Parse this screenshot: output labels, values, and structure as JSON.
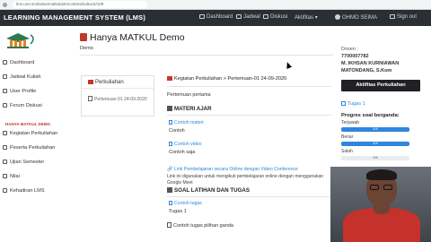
{
  "browser": {
    "url": "lms.umr.sm/kelas/matkul/ptmcontent/index/4/109"
  },
  "navbar": {
    "brand": "LEARNING MANAGEMENT SYSTEM (LMS)",
    "links": [
      "Dashboard",
      "Jadwal",
      "Diskusi",
      "Aktifitas"
    ],
    "user": "OHMO SEIMA",
    "signout": "Sign out"
  },
  "sidebar": {
    "items": [
      "Dashboard",
      "Jadwal Kuliah",
      "User Profile",
      "Forum Diskusi"
    ],
    "section_title": "HANYA MATKUL DEMO",
    "course_items": [
      "Kegiatan Perkuliahan",
      "Peserta Perkuliahan",
      "Ujian Semester",
      "Nilai",
      "Kehadiran LMS"
    ]
  },
  "main": {
    "title": "Hanya MATKUL Demo",
    "breadcrumb": "Demo",
    "lecture_card": {
      "header": "Perkuliahan",
      "item": "Pertemuan-01 24-09-2020"
    },
    "path": "Kegiatan Perkuliahan > Pertemuan-01 24-09-2020",
    "meeting_label": "Pertemuan pertama",
    "materi": {
      "heading": "MATERI AJAR",
      "items": [
        {
          "link": "Contoh materi",
          "text": "Contoh"
        },
        {
          "link": "Contoh video",
          "text": "Contoh saja"
        }
      ]
    },
    "video_conf": {
      "link": "Link Pembelajaran secara Online dengan Video Conference",
      "desc": "Link ini digunakan untuk mengikuti pembelajaran online dengan menggunakan Google Meet"
    },
    "soal": {
      "heading": "SOAL LATIHAN DAN TUGAS",
      "link": "Contoh tugas",
      "text": "Tugas 1",
      "mc": "Contoh tugas pilihan ganda"
    }
  },
  "right_panel": {
    "dosen_label": "Dosen :",
    "nip": "7700007782",
    "name": "M. IKHSAN KURNIAWAN",
    "place": "MATONDANG, S.Kom",
    "button": "Aktifitas Perkuliahan",
    "task": "Tugas 1",
    "progress_title": "Progres soal berganda:",
    "progress": [
      {
        "label": "Terjawab",
        "value": "4/4",
        "fraction": 1.0
      },
      {
        "label": "Benar",
        "value": "4/4",
        "fraction": 1.0
      },
      {
        "label": "Salah",
        "value": "0/4",
        "fraction": 0.0
      }
    ]
  },
  "colors": {
    "navbar": "#2b2f33",
    "accent_red": "#c0392b",
    "link_blue": "#2e86de",
    "button_dark": "#1f2124"
  }
}
